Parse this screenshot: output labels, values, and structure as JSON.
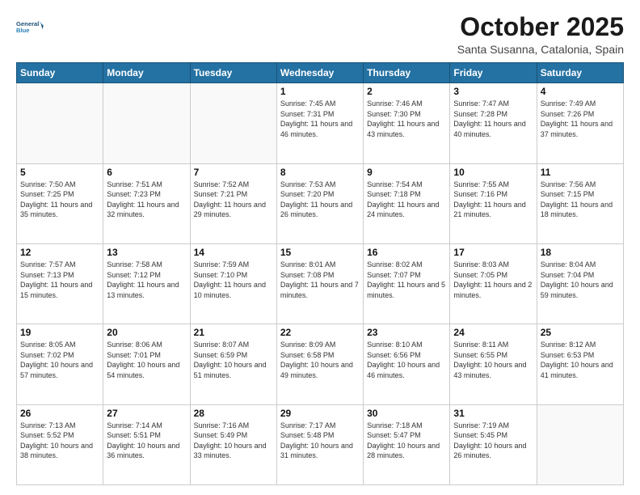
{
  "header": {
    "logo_line1": "General",
    "logo_line2": "Blue",
    "month": "October 2025",
    "location": "Santa Susanna, Catalonia, Spain"
  },
  "weekdays": [
    "Sunday",
    "Monday",
    "Tuesday",
    "Wednesday",
    "Thursday",
    "Friday",
    "Saturday"
  ],
  "weeks": [
    [
      {
        "day": "",
        "info": ""
      },
      {
        "day": "",
        "info": ""
      },
      {
        "day": "",
        "info": ""
      },
      {
        "day": "1",
        "info": "Sunrise: 7:45 AM\nSunset: 7:31 PM\nDaylight: 11 hours and 46 minutes."
      },
      {
        "day": "2",
        "info": "Sunrise: 7:46 AM\nSunset: 7:30 PM\nDaylight: 11 hours and 43 minutes."
      },
      {
        "day": "3",
        "info": "Sunrise: 7:47 AM\nSunset: 7:28 PM\nDaylight: 11 hours and 40 minutes."
      },
      {
        "day": "4",
        "info": "Sunrise: 7:49 AM\nSunset: 7:26 PM\nDaylight: 11 hours and 37 minutes."
      }
    ],
    [
      {
        "day": "5",
        "info": "Sunrise: 7:50 AM\nSunset: 7:25 PM\nDaylight: 11 hours and 35 minutes."
      },
      {
        "day": "6",
        "info": "Sunrise: 7:51 AM\nSunset: 7:23 PM\nDaylight: 11 hours and 32 minutes."
      },
      {
        "day": "7",
        "info": "Sunrise: 7:52 AM\nSunset: 7:21 PM\nDaylight: 11 hours and 29 minutes."
      },
      {
        "day": "8",
        "info": "Sunrise: 7:53 AM\nSunset: 7:20 PM\nDaylight: 11 hours and 26 minutes."
      },
      {
        "day": "9",
        "info": "Sunrise: 7:54 AM\nSunset: 7:18 PM\nDaylight: 11 hours and 24 minutes."
      },
      {
        "day": "10",
        "info": "Sunrise: 7:55 AM\nSunset: 7:16 PM\nDaylight: 11 hours and 21 minutes."
      },
      {
        "day": "11",
        "info": "Sunrise: 7:56 AM\nSunset: 7:15 PM\nDaylight: 11 hours and 18 minutes."
      }
    ],
    [
      {
        "day": "12",
        "info": "Sunrise: 7:57 AM\nSunset: 7:13 PM\nDaylight: 11 hours and 15 minutes."
      },
      {
        "day": "13",
        "info": "Sunrise: 7:58 AM\nSunset: 7:12 PM\nDaylight: 11 hours and 13 minutes."
      },
      {
        "day": "14",
        "info": "Sunrise: 7:59 AM\nSunset: 7:10 PM\nDaylight: 11 hours and 10 minutes."
      },
      {
        "day": "15",
        "info": "Sunrise: 8:01 AM\nSunset: 7:08 PM\nDaylight: 11 hours and 7 minutes."
      },
      {
        "day": "16",
        "info": "Sunrise: 8:02 AM\nSunset: 7:07 PM\nDaylight: 11 hours and 5 minutes."
      },
      {
        "day": "17",
        "info": "Sunrise: 8:03 AM\nSunset: 7:05 PM\nDaylight: 11 hours and 2 minutes."
      },
      {
        "day": "18",
        "info": "Sunrise: 8:04 AM\nSunset: 7:04 PM\nDaylight: 10 hours and 59 minutes."
      }
    ],
    [
      {
        "day": "19",
        "info": "Sunrise: 8:05 AM\nSunset: 7:02 PM\nDaylight: 10 hours and 57 minutes."
      },
      {
        "day": "20",
        "info": "Sunrise: 8:06 AM\nSunset: 7:01 PM\nDaylight: 10 hours and 54 minutes."
      },
      {
        "day": "21",
        "info": "Sunrise: 8:07 AM\nSunset: 6:59 PM\nDaylight: 10 hours and 51 minutes."
      },
      {
        "day": "22",
        "info": "Sunrise: 8:09 AM\nSunset: 6:58 PM\nDaylight: 10 hours and 49 minutes."
      },
      {
        "day": "23",
        "info": "Sunrise: 8:10 AM\nSunset: 6:56 PM\nDaylight: 10 hours and 46 minutes."
      },
      {
        "day": "24",
        "info": "Sunrise: 8:11 AM\nSunset: 6:55 PM\nDaylight: 10 hours and 43 minutes."
      },
      {
        "day": "25",
        "info": "Sunrise: 8:12 AM\nSunset: 6:53 PM\nDaylight: 10 hours and 41 minutes."
      }
    ],
    [
      {
        "day": "26",
        "info": "Sunrise: 7:13 AM\nSunset: 5:52 PM\nDaylight: 10 hours and 38 minutes."
      },
      {
        "day": "27",
        "info": "Sunrise: 7:14 AM\nSunset: 5:51 PM\nDaylight: 10 hours and 36 minutes."
      },
      {
        "day": "28",
        "info": "Sunrise: 7:16 AM\nSunset: 5:49 PM\nDaylight: 10 hours and 33 minutes."
      },
      {
        "day": "29",
        "info": "Sunrise: 7:17 AM\nSunset: 5:48 PM\nDaylight: 10 hours and 31 minutes."
      },
      {
        "day": "30",
        "info": "Sunrise: 7:18 AM\nSunset: 5:47 PM\nDaylight: 10 hours and 28 minutes."
      },
      {
        "day": "31",
        "info": "Sunrise: 7:19 AM\nSunset: 5:45 PM\nDaylight: 10 hours and 26 minutes."
      },
      {
        "day": "",
        "info": ""
      }
    ]
  ]
}
